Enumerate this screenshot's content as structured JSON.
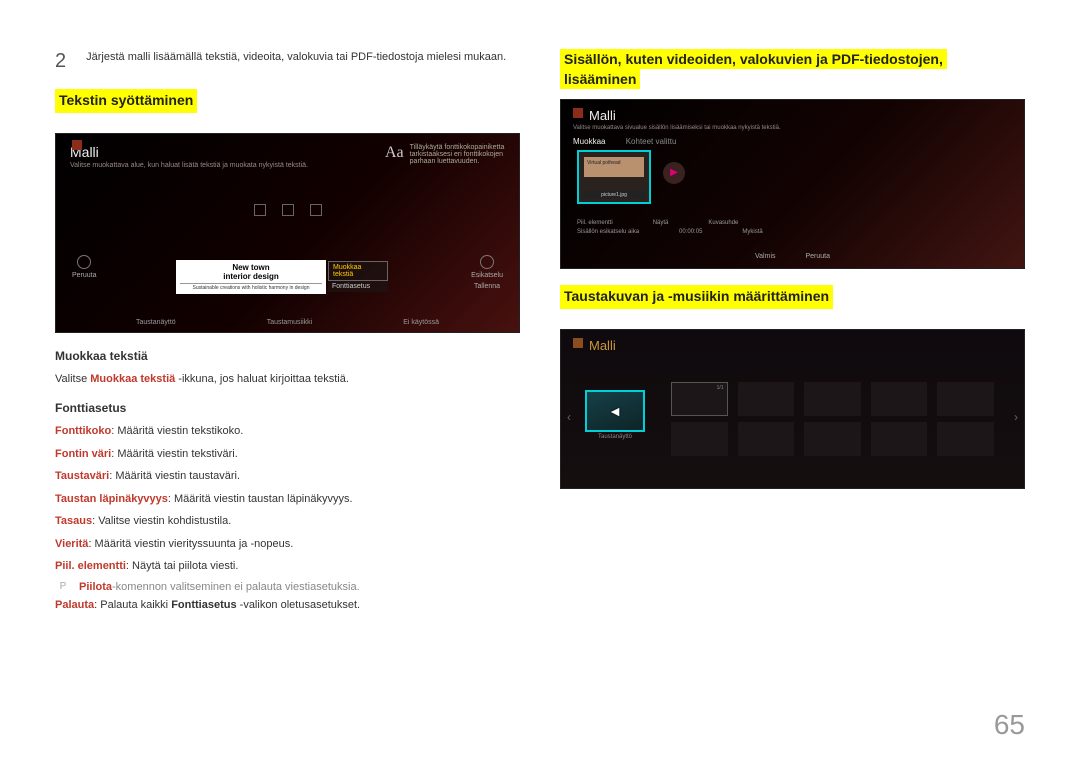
{
  "left": {
    "step_num": "2",
    "step_text": "Järjestä malli lisäämällä tekstiä, videoita, valokuvia tai PDF-tiedostoja mielesi mukaan.",
    "heading1": "Tekstin syöttäminen",
    "ss1": {
      "title": "Malli",
      "subtitle": "Valitse muokattava alue, kun haluat lisätä tekstiä ja muokata nykyistä tekstiä.",
      "aa": "Aa",
      "aa_desc": "Tilläykäytä fonttikokopainiketta tarkistaaksesi eri fonttikokojen parhaan luettavuuden.",
      "left_icon_label": "Peruuta",
      "right_icon_top": "Esikatselu",
      "right_icon_bottom": "Tallenna",
      "textbox_l1": "New town",
      "textbox_l2": "interior design",
      "textbox_l3": "Sustainable creations with holistic harmony in design",
      "popup_sel": "Muokkaa tekstiä",
      "popup_2": "Fonttiasetus",
      "bottom1": "Taustanäyttö",
      "bottom2": "Taustamusiikki",
      "bottom3": "Ei käytössä"
    },
    "h_muokkaa": "Muokkaa tekstiä",
    "p_muokkaa_pre": "Valitse ",
    "p_muokkaa_strong": "Muokkaa tekstiä",
    "p_muokkaa_post": " -ikkuna, jos haluat kirjoittaa tekstiä.",
    "h_fontti": "Fonttiasetus",
    "defs": [
      {
        "k": "Fonttikoko",
        "v": ": Määritä viestin tekstikoko."
      },
      {
        "k": "Fontin väri",
        "v": ": Määritä viestin tekstiväri."
      },
      {
        "k": "Taustaväri",
        "v": ": Määritä viestin taustaväri."
      },
      {
        "k": "Taustan läpinäkyvyys",
        "v": ": Määritä viestin taustan läpinäkyvyys."
      },
      {
        "k": "Tasaus",
        "v": ": Valitse viestin kohdistustila."
      },
      {
        "k": "Vieritä",
        "v": ": Määritä viestin vierityssuunta ja -nopeus."
      },
      {
        "k": "Piil. elementti",
        "v": ": Näytä tai piilota viesti."
      }
    ],
    "note_strong": "Piilota",
    "note_rest": "-komennon valitseminen ei palauta viestiasetuksia.",
    "palauta_k": "Palauta",
    "palauta_v1": ": Palauta kaikki ",
    "palauta_v2": "Fonttiasetus",
    "palauta_v3": " -valikon oletusasetukset."
  },
  "right": {
    "heading1a": "Sisällön, kuten videoiden, valokuvien ja PDF-tiedostojen,",
    "heading1b": "lisääminen",
    "ss2": {
      "title": "Malli",
      "subtitle": "Valitse muokattava sivualue sisällön lisäämiseksi tai muokkaa nykyistä tekstiä.",
      "tab1": "Muokkaa",
      "tab2": "Kohteet valittu",
      "thumb_text": "Virtual pothead",
      "thumb_label": "picture1.jpg",
      "meta_r1_a": "Piil. elementti",
      "meta_r1_b": "Näytä",
      "meta_r1_c": "Kuvasuhde",
      "meta_r2_a": "Sisällön esikatselu aika",
      "meta_r2_b": "00:00:05",
      "meta_r2_c": "Mykistä",
      "btn1": "Valmis",
      "btn2": "Peruuta"
    },
    "heading2": "Taustakuvan ja -musiikin määrittäminen",
    "ss3": {
      "title": "Malli",
      "thumb_label": "Taustanäyttö",
      "g_labels": [
        "1/1",
        "",
        "",
        "",
        "",
        "",
        "",
        "",
        "",
        ""
      ]
    }
  },
  "page_number": "65"
}
